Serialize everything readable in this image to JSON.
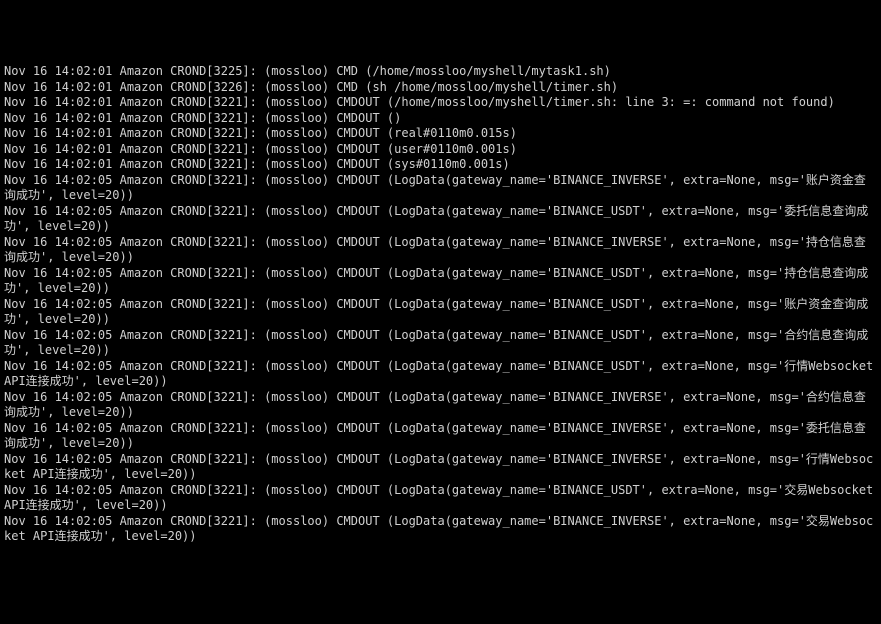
{
  "lines": [
    "Nov 16 14:02:01 Amazon CROND[3225]: (mossloo) CMD (/home/mossloo/myshell/mytask1.sh)",
    "Nov 16 14:02:01 Amazon CROND[3226]: (mossloo) CMD (sh /home/mossloo/myshell/timer.sh)",
    "Nov 16 14:02:01 Amazon CROND[3221]: (mossloo) CMDOUT (/home/mossloo/myshell/timer.sh: line 3: =: command not found)",
    "Nov 16 14:02:01 Amazon CROND[3221]: (mossloo) CMDOUT ()",
    "Nov 16 14:02:01 Amazon CROND[3221]: (mossloo) CMDOUT (real#0110m0.015s)",
    "Nov 16 14:02:01 Amazon CROND[3221]: (mossloo) CMDOUT (user#0110m0.001s)",
    "Nov 16 14:02:01 Amazon CROND[3221]: (mossloo) CMDOUT (sys#0110m0.001s)",
    "Nov 16 14:02:05 Amazon CROND[3221]: (mossloo) CMDOUT (LogData(gateway_name='BINANCE_INVERSE', extra=None, msg='账户资金查询成功', level=20))",
    "Nov 16 14:02:05 Amazon CROND[3221]: (mossloo) CMDOUT (LogData(gateway_name='BINANCE_USDT', extra=None, msg='委托信息查询成功', level=20))",
    "Nov 16 14:02:05 Amazon CROND[3221]: (mossloo) CMDOUT (LogData(gateway_name='BINANCE_INVERSE', extra=None, msg='持仓信息查询成功', level=20))",
    "Nov 16 14:02:05 Amazon CROND[3221]: (mossloo) CMDOUT (LogData(gateway_name='BINANCE_USDT', extra=None, msg='持仓信息查询成功', level=20))",
    "Nov 16 14:02:05 Amazon CROND[3221]: (mossloo) CMDOUT (LogData(gateway_name='BINANCE_USDT', extra=None, msg='账户资金查询成功', level=20))",
    "Nov 16 14:02:05 Amazon CROND[3221]: (mossloo) CMDOUT (LogData(gateway_name='BINANCE_USDT', extra=None, msg='合约信息查询成功', level=20))",
    "Nov 16 14:02:05 Amazon CROND[3221]: (mossloo) CMDOUT (LogData(gateway_name='BINANCE_USDT', extra=None, msg='行情Websocket API连接成功', level=20))",
    "Nov 16 14:02:05 Amazon CROND[3221]: (mossloo) CMDOUT (LogData(gateway_name='BINANCE_INVERSE', extra=None, msg='合约信息查询成功', level=20))",
    "Nov 16 14:02:05 Amazon CROND[3221]: (mossloo) CMDOUT (LogData(gateway_name='BINANCE_INVERSE', extra=None, msg='委托信息查询成功', level=20))",
    "Nov 16 14:02:05 Amazon CROND[3221]: (mossloo) CMDOUT (LogData(gateway_name='BINANCE_INVERSE', extra=None, msg='行情Websocket API连接成功', level=20))",
    "Nov 16 14:02:05 Amazon CROND[3221]: (mossloo) CMDOUT (LogData(gateway_name='BINANCE_USDT', extra=None, msg='交易Websocket API连接成功', level=20))",
    "Nov 16 14:02:05 Amazon CROND[3221]: (mossloo) CMDOUT (LogData(gateway_name='BINANCE_INVERSE', extra=None, msg='交易Websocket API连接成功', level=20))"
  ]
}
